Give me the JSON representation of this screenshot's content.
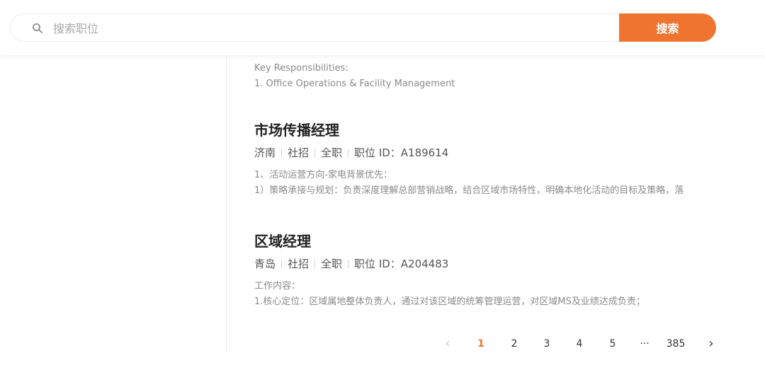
{
  "search": {
    "placeholder": "搜索职位",
    "button_label": "搜索"
  },
  "prev_snippet": {
    "line1": "Key Responsibilities:",
    "line2": "1. Office Operations & Facility Management"
  },
  "jobs": [
    {
      "title": "市场传播经理",
      "city": "济南",
      "recruit_type": "社招",
      "employment": "全职",
      "id_label": "职位 ID：A189614",
      "desc1": "1、活动运营方向-家电背景优先：",
      "desc2": "1）策略承接与规划：负责深度理解总部营销战略，结合区域市场特性，明确本地化活动的目标及策略，落"
    },
    {
      "title": "区域经理",
      "city": "青岛",
      "recruit_type": "社招",
      "employment": "全职",
      "id_label": "职位 ID：A204483",
      "desc1": "工作内容：",
      "desc2": "1.核心定位：区域属地整体负责人，通过对该区域的统筹管理运营，对区域MS及业绩达成负责；"
    }
  ],
  "pagination": {
    "prev": "‹",
    "pages": [
      "1",
      "2",
      "3",
      "4",
      "5"
    ],
    "current": "1",
    "ellipsis": "···",
    "last": "385",
    "next": "›"
  },
  "colors": {
    "accent": "#ef7430"
  }
}
